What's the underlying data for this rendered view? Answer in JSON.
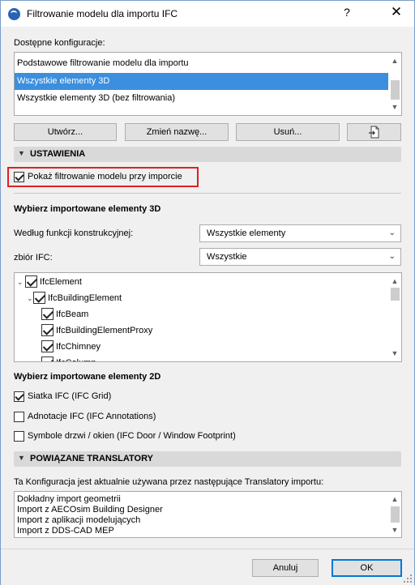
{
  "window": {
    "title": "Filtrowanie modelu dla importu IFC",
    "help_glyph": "?",
    "close_glyph": "✕"
  },
  "configs": {
    "label": "Dostępne konfiguracje:",
    "items": [
      "Podstawowe filtrowanie modelu dla importu",
      "Wszystkie elementy 3D",
      "Wszystkie elementy 3D (bez filtrowania)"
    ],
    "selected_index": 1,
    "buttons": {
      "create": "Utwórz...",
      "rename": "Zmień nazwę...",
      "delete": "Usuń..."
    }
  },
  "settings": {
    "header": "USTAWIENIA",
    "show_filtering_label": "Pokaż filtrowanie modelu przy imporcie",
    "show_filtering_checked": true
  },
  "elements3d": {
    "header": "Wybierz importowane elementy 3D",
    "by_function_label": "Według funkcji konstrukcyjnej:",
    "by_function_value": "Wszystkie elementy",
    "ifc_set_label": "zbiór IFC:",
    "ifc_set_value": "Wszystkie",
    "tree": [
      {
        "label": "IfcElement",
        "level": 0,
        "expanded": true,
        "checked": true
      },
      {
        "label": "IfcBuildingElement",
        "level": 1,
        "expanded": true,
        "checked": true
      },
      {
        "label": "IfcBeam",
        "level": 2,
        "checked": true
      },
      {
        "label": "IfcBuildingElementProxy",
        "level": 2,
        "checked": true
      },
      {
        "label": "IfcChimney",
        "level": 2,
        "checked": true
      },
      {
        "label": "IfcColumn",
        "level": 2,
        "checked": true
      }
    ]
  },
  "elements2d": {
    "header": "Wybierz importowane elementy 2D",
    "items": [
      {
        "label": "Siatka IFC (IFC Grid)",
        "checked": true
      },
      {
        "label": "Adnotacje IFC (IFC Annotations)",
        "checked": false
      },
      {
        "label": "Symbole drzwi / okien (IFC Door / Window Footprint)",
        "checked": false
      }
    ]
  },
  "translators": {
    "header": "POWIĄZANE TRANSLATORY",
    "description": "Ta Konfiguracja jest aktualnie używana przez następujące Translatory importu:",
    "items": [
      "Dokładny import geometrii",
      "Import z AECOsim Building Designer",
      "Import z aplikacji modelujących",
      "Import z DDS-CAD MEP"
    ]
  },
  "footer": {
    "cancel": "Anuluj",
    "ok": "OK"
  }
}
